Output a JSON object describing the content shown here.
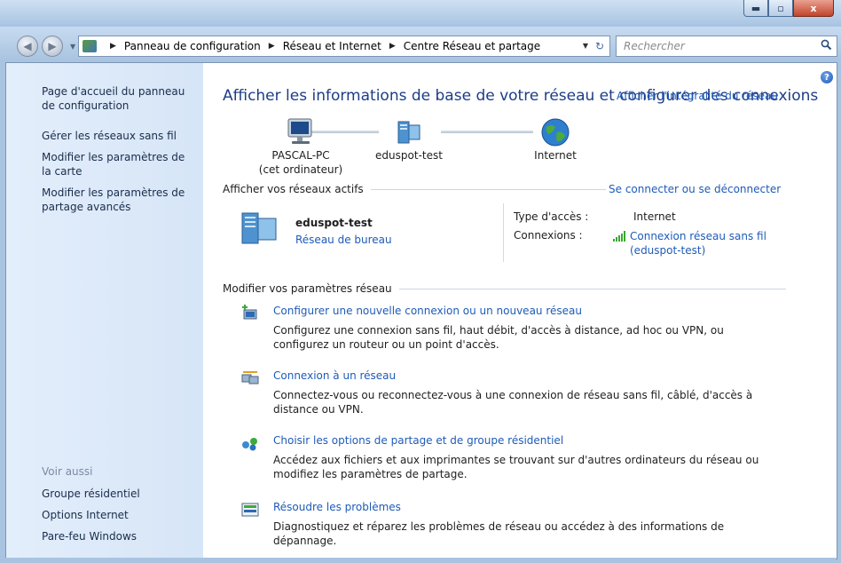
{
  "window": {
    "min_glyph": "▬",
    "max_glyph": "▫",
    "close_glyph": "x"
  },
  "nav": {
    "back_glyph": "◀",
    "forward_glyph": "▶",
    "dropdown_glyph": "▼",
    "breadcrumbs": [
      "Panneau de configuration",
      "Réseau et Internet",
      "Centre Réseau et partage"
    ],
    "separator": "▶",
    "refresh_glyph": "↻",
    "search_placeholder": "Rechercher"
  },
  "sidebar": {
    "links": [
      "Page d'accueil du panneau de configuration",
      "Gérer les réseaux sans fil",
      "Modifier les paramètres de la carte",
      "Modifier les paramètres de partage avancés"
    ],
    "see_also_label": "Voir aussi",
    "see_also": [
      "Groupe résidentiel",
      "Options Internet",
      "Pare-feu Windows"
    ]
  },
  "main": {
    "help_glyph": "?",
    "title": "Afficher les informations de base de votre réseau et configurer des connexions",
    "full_map_link": "Afficher l'intégralité du réseau",
    "map": {
      "computer_name": "PASCAL-PC",
      "computer_note": "(cet ordinateur)",
      "network_name": "eduspot-test",
      "internet_label": "Internet"
    },
    "active_networks_heading": "Afficher vos réseaux actifs",
    "connect_link": "Se connecter ou se déconnecter",
    "active_network": {
      "name": "eduspot-test",
      "type": "Réseau de bureau",
      "access_type_label": "Type d'accès :",
      "access_type_value": "Internet",
      "connections_label": "Connexions :",
      "connection_line1": "Connexion réseau sans fil",
      "connection_line2": "(eduspot-test)"
    },
    "change_settings_heading": "Modifier vos paramètres réseau",
    "tasks": [
      {
        "link": "Configurer une nouvelle connexion ou un nouveau réseau",
        "desc": "Configurez une connexion sans fil, haut débit, d'accès à distance, ad hoc ou VPN, ou configurez un routeur ou un point d'accès."
      },
      {
        "link": "Connexion à un réseau",
        "desc": "Connectez-vous ou reconnectez-vous à une connexion de réseau sans fil, câblé, d'accès à distance ou VPN."
      },
      {
        "link": "Choisir les options de partage et de groupe résidentiel",
        "desc": "Accédez aux fichiers et aux imprimantes se trouvant sur d'autres ordinateurs du réseau ou modifiez les paramètres de partage."
      },
      {
        "link": "Résoudre les problèmes",
        "desc": "Diagnostiquez et réparez les problèmes de réseau ou accédez à des informations de dépannage."
      }
    ]
  }
}
